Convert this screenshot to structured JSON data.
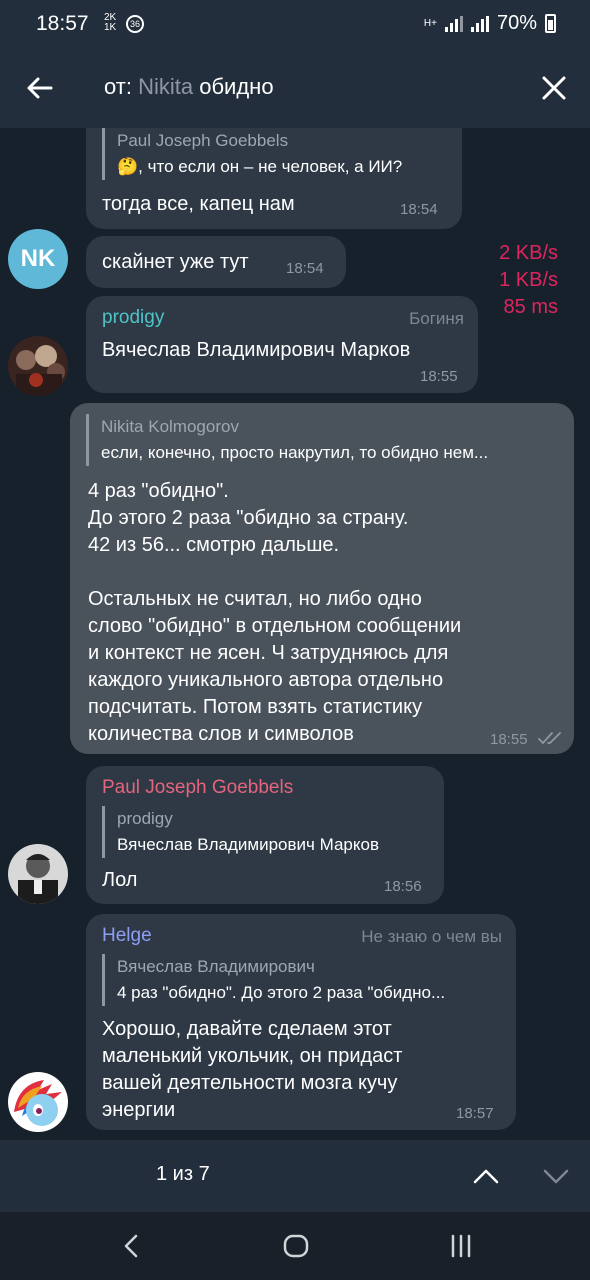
{
  "status_bar": {
    "time": "18:57",
    "data_rate_top": "2K",
    "data_rate_bottom": "1K",
    "notification_count": "36",
    "network_label": "H+",
    "battery": "70%"
  },
  "header": {
    "search_prefix": "от:",
    "search_user": "Nikita",
    "search_query": "обидно"
  },
  "net_overlay": {
    "line1": "2 KB/s",
    "line2": "1 KB/s",
    "line3": "85 ms"
  },
  "messages": [
    {
      "reply_name": "Paul Joseph Goebbels",
      "reply_text": "🤔, что если он – не человек, а ИИ?",
      "text": "тогда все, капец нам",
      "time": "18:54"
    },
    {
      "avatar_initials": "NK",
      "text": "скайнет уже тут",
      "time": "18:54"
    },
    {
      "sender": "prodigy",
      "sender_color": "#4fc3c7",
      "tag": "Богиня",
      "text": "Вячеслав Владимирович Марков",
      "time": "18:55"
    },
    {
      "reply_name": "Nikita Kolmogorov",
      "reply_text": "если, конечно, просто накрутил, то обидно нем...",
      "text_lines": [
        "4 раз \"обидно\".",
        "До этого 2 раза \"обидно за страну.",
        "42 из 56... смотрю дальше.",
        "",
        "Остальных не считал, но либо одно",
        "слово \"обидно\" в отдельном сообщении",
        "и контекст не ясен. Ч затрудняюсь для",
        "каждого уникального автора отдельно",
        "подсчитать. Потом взять статистику",
        "количества слов и символов"
      ],
      "time": "18:55",
      "outgoing": true
    },
    {
      "sender": "Paul Joseph Goebbels",
      "sender_color": "#e5647e",
      "reply_name": "prodigy",
      "reply_text": "Вячеслав Владимирович Марков",
      "text": "Лол",
      "time": "18:56"
    },
    {
      "sender": "Helge",
      "sender_color": "#8e9ef5",
      "tag": "Не знаю о чем вы",
      "reply_name": "Вячеслав Владимирович",
      "reply_text": "4 раз \"обидно\". До этого 2 раза \"обидно...",
      "text_lines": [
        "Хорошо, давайте сделаем этот",
        "маленький укольчик, он придаст",
        "вашей деятельности мозга кучу",
        "энергии"
      ],
      "time": "18:57"
    }
  ],
  "search_nav": {
    "counter": "1 из 7"
  },
  "icons": {
    "back": "arrow-left-icon",
    "close": "close-icon",
    "up": "chevron-up-icon",
    "down": "chevron-down-icon",
    "read": "double-check-icon"
  }
}
